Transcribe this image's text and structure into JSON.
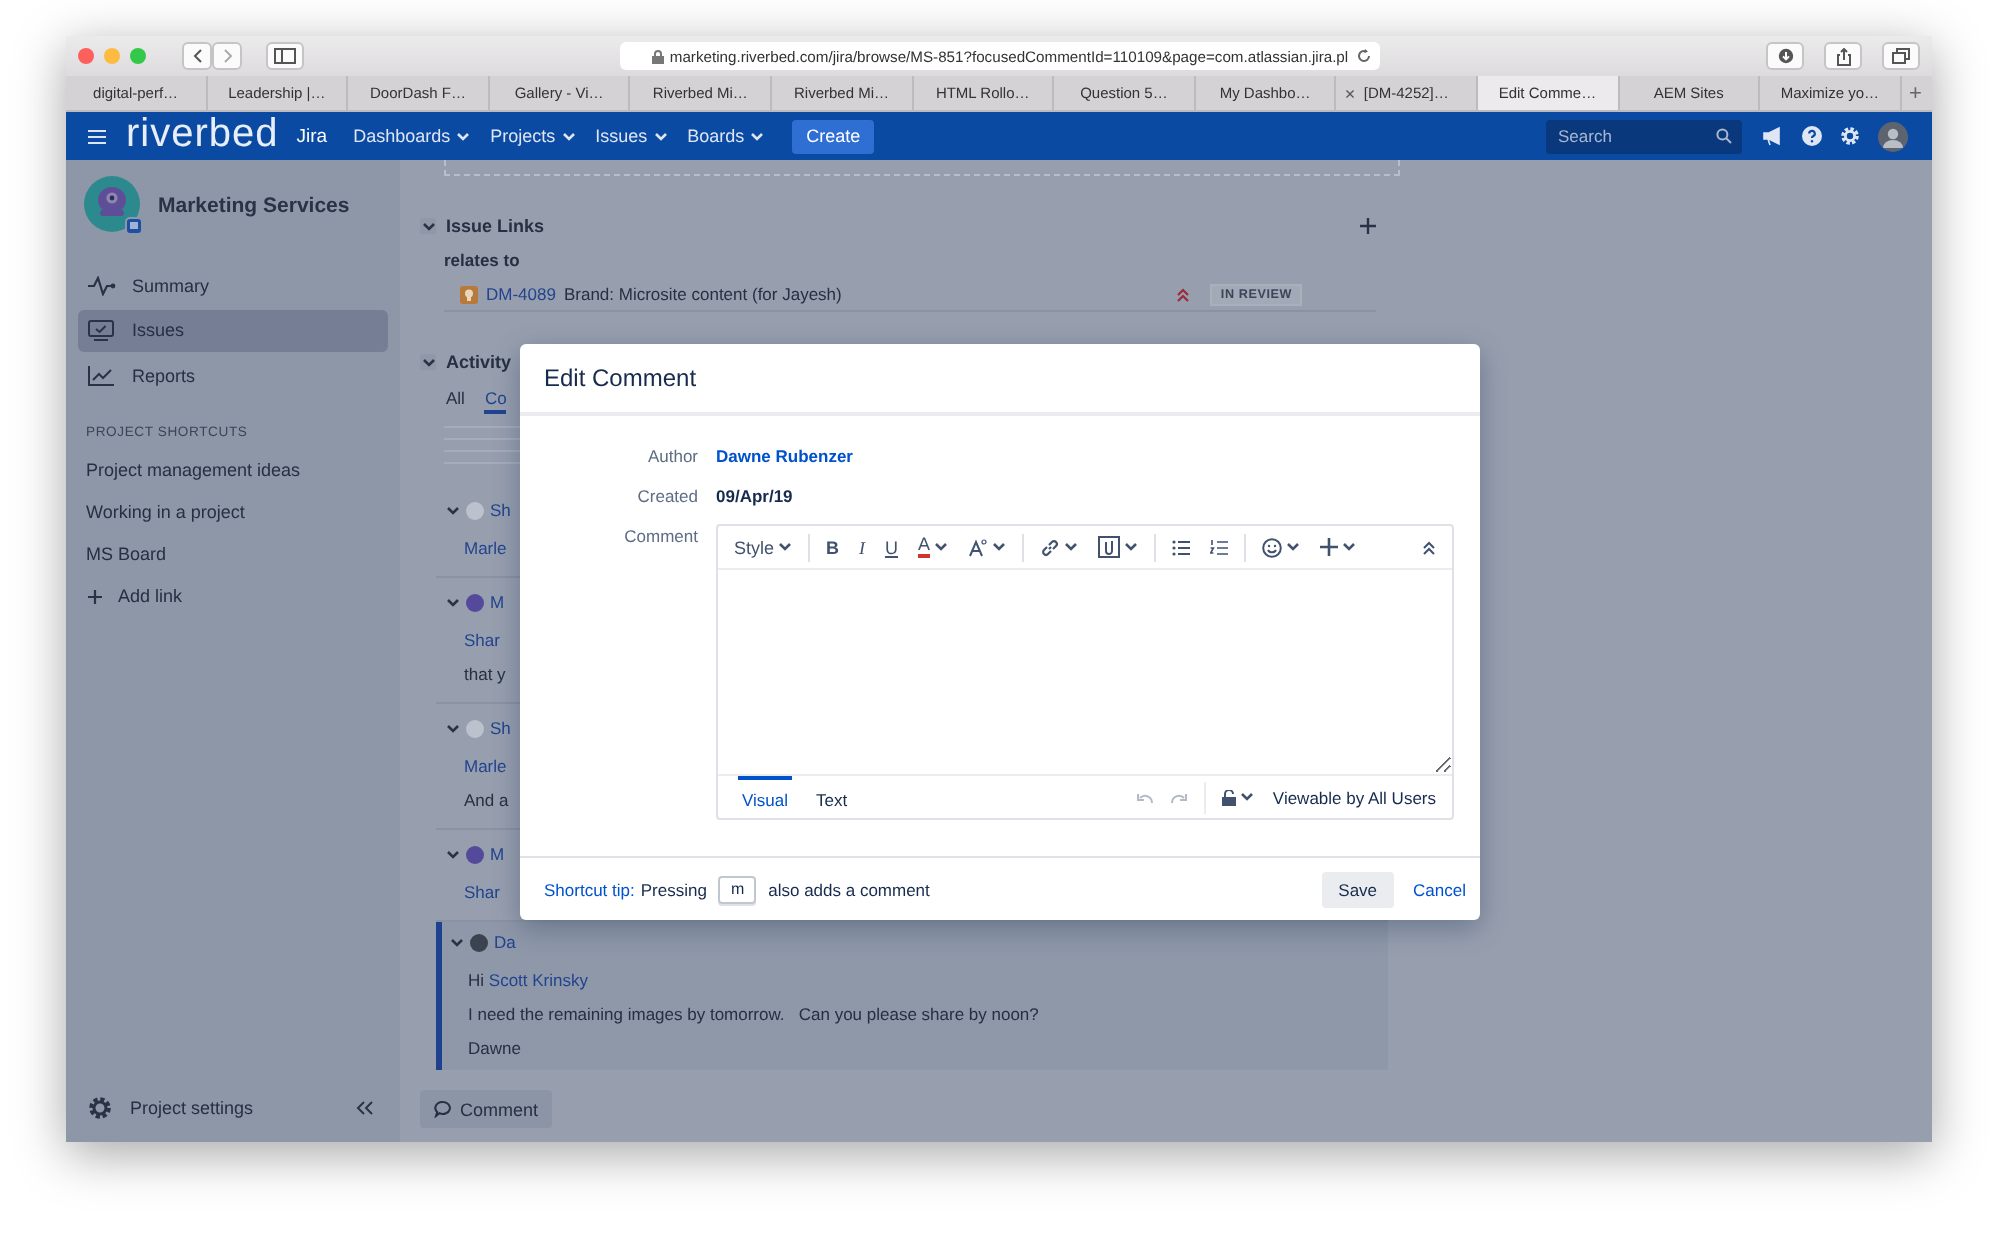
{
  "browser": {
    "url": "marketing.riverbed.com/jira/browse/MS-851?focusedCommentId=110109&page=com.atlassian.jira.pl",
    "tabs": [
      {
        "label": "digital-perf…",
        "selected": false
      },
      {
        "label": "Leadership |…",
        "selected": false
      },
      {
        "label": "DoorDash F…",
        "selected": false
      },
      {
        "label": "Gallery - Vi…",
        "selected": false
      },
      {
        "label": "Riverbed Mi…",
        "selected": false
      },
      {
        "label": "Riverbed Mi…",
        "selected": false
      },
      {
        "label": "HTML Rollo…",
        "selected": false
      },
      {
        "label": "Question 5…",
        "selected": false
      },
      {
        "label": "My Dashbo…",
        "selected": false
      },
      {
        "label": "[DM-4252]…",
        "selected": false,
        "close": "×"
      },
      {
        "label": "Edit Comme…",
        "selected": true
      },
      {
        "label": "AEM Sites",
        "selected": false
      },
      {
        "label": "Maximize yo…",
        "selected": false
      }
    ],
    "new_tab": "+"
  },
  "nav": {
    "logo": "riverbed",
    "product": "Jira",
    "menus": [
      {
        "label": "Dashboards"
      },
      {
        "label": "Projects"
      },
      {
        "label": "Issues"
      },
      {
        "label": "Boards"
      }
    ],
    "create": "Create",
    "search": {
      "placeholder": "Search"
    }
  },
  "sidebar": {
    "project": "Marketing Services",
    "items": [
      {
        "kind": "summary",
        "label": "Summary",
        "selected": false
      },
      {
        "kind": "issues",
        "label": "Issues",
        "selected": true
      },
      {
        "kind": "reports",
        "label": "Reports",
        "selected": false
      }
    ],
    "shortcuts_heading": "PROJECT SHORTCUTS",
    "shortcuts": [
      "Project management ideas",
      "Working in a project",
      "MS Board"
    ],
    "add_link": "Add link",
    "settings": "Project settings"
  },
  "issue_links": {
    "title": "Issue Links",
    "relation": "relates to",
    "links": [
      {
        "key": "DM-4089",
        "summary": "Brand: Microsite content (for Jayesh)",
        "status": "IN REVIEW"
      }
    ]
  },
  "activity": {
    "title": "Activity",
    "tabs": [
      {
        "label": "All",
        "selected": false
      },
      {
        "label": "Co",
        "selected": true
      }
    ],
    "entries": [
      {
        "author": "Sh",
        "color": "#bcc2cd",
        "highlighted": false,
        "lines": [
          {
            "kind": "link",
            "text": "Marle"
          }
        ]
      },
      {
        "author": "M",
        "color": "#54499a",
        "highlighted": false,
        "lines": [
          {
            "kind": "link",
            "text": "Shar"
          },
          {
            "kind": "text",
            "text": "that y"
          }
        ]
      },
      {
        "author": "Sh",
        "color": "#bcc2cd",
        "highlighted": false,
        "lines": [
          {
            "kind": "link",
            "text": "Marle"
          },
          {
            "kind": "text",
            "text": "And a"
          }
        ]
      },
      {
        "author": "M",
        "color": "#54499a",
        "highlighted": false,
        "lines": [
          {
            "kind": "link",
            "text": "Shar"
          }
        ]
      },
      {
        "author": "Da",
        "color": "#3b4250",
        "highlighted": true,
        "lines": [
          {
            "kind": "mention",
            "text": "Hi",
            "link": "Scott Krinsky"
          },
          {
            "kind": "text",
            "text": "I need the remaining images by tomorrow.   Can you please share by noon?"
          },
          {
            "kind": "text",
            "text": "Dawne"
          }
        ]
      }
    ],
    "comment_button": "Comment"
  },
  "dialog": {
    "title": "Edit Comment",
    "fields": [
      {
        "label": "Author",
        "value": "Dawne Rubenzer",
        "kind": "link"
      },
      {
        "label": "Created",
        "value": "09/Apr/19",
        "kind": "text"
      }
    ],
    "comment_label": "Comment",
    "toolbar": [
      [
        {
          "kind": "style",
          "label": "Style",
          "menu": true
        }
      ],
      [
        {
          "kind": "bold",
          "label": "B",
          "menu": false
        },
        {
          "kind": "italic",
          "label": "I",
          "menu": false
        },
        {
          "kind": "underline",
          "label": "U",
          "menu": false
        },
        {
          "kind": "color",
          "label": "A",
          "menu": true
        },
        {
          "kind": "format",
          "menu": true
        }
      ],
      [
        {
          "kind": "link",
          "menu": true
        },
        {
          "kind": "attach",
          "menu": true
        }
      ],
      [
        {
          "kind": "bullets",
          "menu": false
        },
        {
          "kind": "numbers",
          "menu": false
        }
      ],
      [
        {
          "kind": "emoji",
          "menu": true
        },
        {
          "kind": "insert",
          "menu": true
        }
      ]
    ],
    "modes": [
      {
        "label": "Visual",
        "selected": true
      },
      {
        "label": "Text",
        "selected": false
      }
    ],
    "visibility": "Viewable by All Users",
    "tip_link": "Shortcut tip:",
    "tip_before": "Pressing",
    "tip_key": "m",
    "tip_after": "also adds a comment",
    "save": "Save",
    "cancel": "Cancel"
  }
}
